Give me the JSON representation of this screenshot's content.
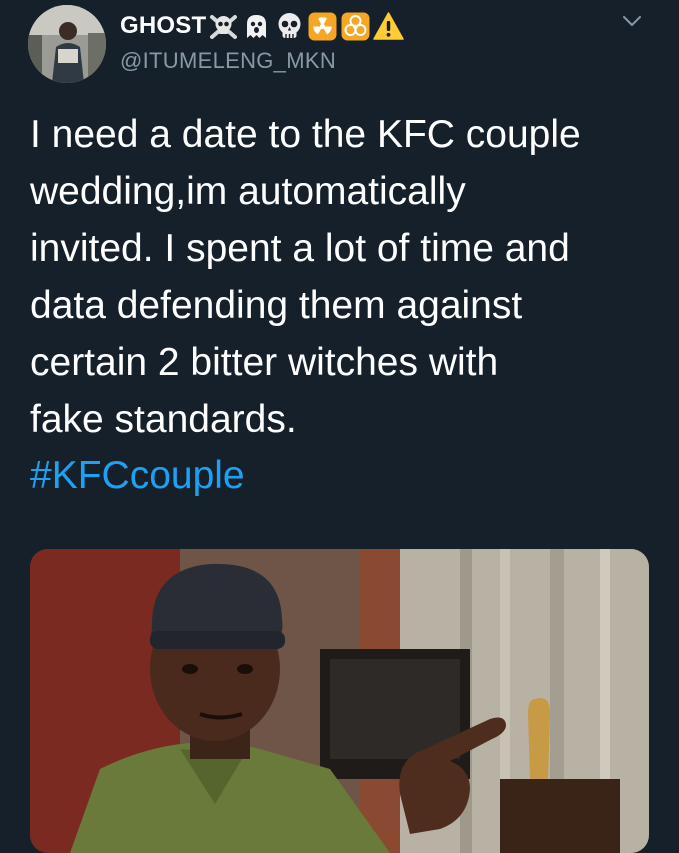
{
  "user": {
    "display_name": "GHOST",
    "handle": "@ITUMELENG_MKN",
    "name_emojis": [
      "skull-crossbones-icon",
      "ghost-icon",
      "skull-icon",
      "radioactive-icon",
      "biohazard-icon",
      "warning-icon"
    ]
  },
  "tweet": {
    "text": "I need a date to the KFC couple\nwedding,im automatically\ninvited. I spent a lot of time and\ndata defending them against\ncertain 2 bitter witches with\nfake standards.",
    "hashtag": "#KFCcouple"
  },
  "colors": {
    "background": "#15202b",
    "text": "#ffffff",
    "secondary_text": "#8899a6",
    "link": "#1da1f2"
  }
}
